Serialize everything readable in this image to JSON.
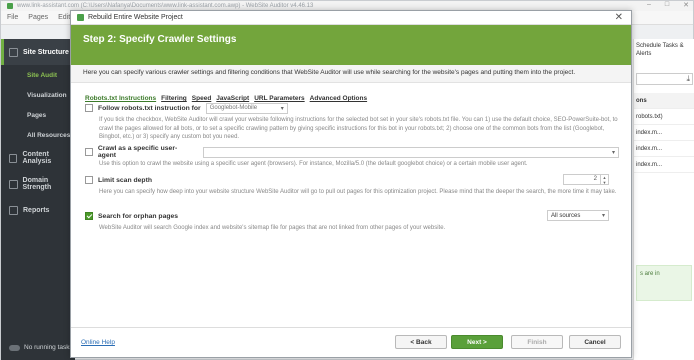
{
  "app": {
    "title": "www.link-assistant.com (C:\\Users\\Nafanya\\Documents\\www.link-assistant.com.awp) - WebSite Auditor v4.46.13",
    "menu": [
      "File",
      "Pages",
      "Edit"
    ],
    "window_controls": [
      "–",
      "□",
      "✕"
    ],
    "sidebar": {
      "sections": [
        {
          "label": "Site Structure",
          "active": true,
          "icon": "sitemap-icon"
        },
        {
          "label": "Content Analysis",
          "active": false,
          "icon": "content-icon"
        },
        {
          "label": "Domain Strength",
          "active": false,
          "icon": "strength-icon"
        },
        {
          "label": "Reports",
          "active": false,
          "icon": "reports-icon"
        }
      ],
      "sub_items": [
        "Site Audit",
        "Visualization",
        "Pages",
        "All Resources"
      ],
      "bottom": "No running tasks"
    },
    "right_panel": {
      "header": "Schedule Tasks & Alerts",
      "rows": [
        "ons",
        "robots.txt)",
        "index.m...",
        "index.m...",
        "index.m..."
      ],
      "green_box": "s are in"
    }
  },
  "dialog": {
    "title": "Rebuild Entire Website Project",
    "close": "✕",
    "step_title": "Step 2: Specify Crawler Settings",
    "description": "Here you can specify various crawler settings and filtering conditions that WebSite Auditor will use while searching for the website's pages and putting them into the project.",
    "tabs": [
      {
        "label": "Robots.txt Instructions",
        "active": true
      },
      {
        "label": "Filtering",
        "active": false
      },
      {
        "label": "Speed",
        "active": false
      },
      {
        "label": "JavaScript",
        "active": false
      },
      {
        "label": "URL Parameters",
        "active": false
      },
      {
        "label": "Advanced Options",
        "active": false
      }
    ],
    "options": {
      "robots": {
        "label": "Follow robots.txt instruction for",
        "checked": false,
        "select": "Googlebot-Mobile",
        "help": "If you tick the checkbox, WebSite Auditor will crawl your website following instructions for the selected bot set in your site's robots.txt file. You can 1) use the default choice, SEO-PowerSuite-bot, to crawl the pages allowed for all bots, or to set a specific crawling pattern by giving specific instructions for this bot in your robots.txt; 2) choose one of the common bots from the list (Googlebot, Bingbot, etc.) or 3) specify any custom bot you need."
      },
      "user_agent": {
        "label": "Crawl as a specific user-agent",
        "checked": false,
        "select": "",
        "help": "Use this option to crawl the website using a specific user agent (browsers). For instance, Mozilla/5.0 (the default googlebot choice) or a certain mobile user agent."
      },
      "depth": {
        "label": "Limit scan depth",
        "checked": false,
        "value": "2",
        "help": "Here you can specify how deep into your website structure WebSite Auditor will go to pull out pages for this optimization project. Please mind that the deeper the search, the more time it may take."
      },
      "orphan": {
        "label": "Search for orphan pages",
        "checked": true,
        "select": "All sources",
        "help": "WebSite Auditor will search Google index and website's sitemap file for pages that are not linked from other pages of your website."
      }
    },
    "footer": {
      "help": "Online Help",
      "back": "< Back",
      "next": "Next >",
      "finish": "Finish",
      "cancel": "Cancel"
    }
  }
}
